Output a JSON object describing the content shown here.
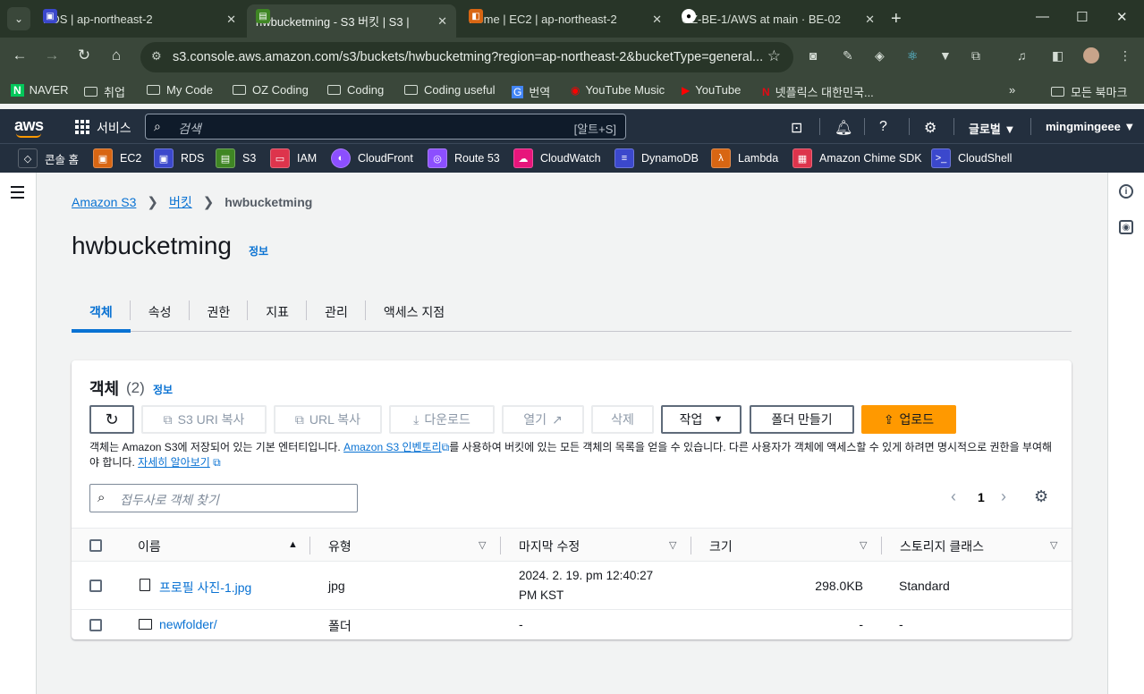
{
  "browser": {
    "tabs": [
      {
        "title": "RDS | ap-northeast-2",
        "color": "#3b48cc",
        "icon": "rds-icon"
      },
      {
        "title": "hwbucketming - S3 버킷 | S3 |",
        "color": "#3f8624",
        "icon": "s3-icon"
      },
      {
        "title": "Home | EC2 | ap-northeast-2",
        "color": "#d86613",
        "icon": "ec2-icon"
      },
      {
        "title": "OZ-BE-1/AWS at main · BE-02",
        "color": "#000000",
        "icon": "github-icon"
      }
    ],
    "url": "s3.console.aws.amazon.com/s3/buckets/hwbucketming?region=ap-northeast-2&bucketType=general...",
    "bookmarks": [
      "NAVER",
      "취업",
      "My Code",
      "OZ Coding",
      "Coding",
      "Coding useful",
      "번역",
      "YouTube Music",
      "YouTube",
      "넷플릭스 대한민국...",
      "모든 북마크"
    ]
  },
  "aws": {
    "logo": "aws",
    "services_label": "서비스",
    "search_placeholder": "검색",
    "search_shortcut": "[알트+S]",
    "region": "글로벌 ▼",
    "user": "mingmingeee ▼",
    "favorites": [
      {
        "label": "콘솔 홈",
        "color": "#232f3e"
      },
      {
        "label": "EC2",
        "color": "#d86613"
      },
      {
        "label": "RDS",
        "color": "#3b48cc"
      },
      {
        "label": "S3",
        "color": "#3f8624"
      },
      {
        "label": "IAM",
        "color": "#dd344c"
      },
      {
        "label": "CloudFront",
        "color": "#8c4fff"
      },
      {
        "label": "Route 53",
        "color": "#8c4fff"
      },
      {
        "label": "CloudWatch",
        "color": "#e7157b"
      },
      {
        "label": "DynamoDB",
        "color": "#3b48cc"
      },
      {
        "label": "Lambda",
        "color": "#d86613"
      },
      {
        "label": "Amazon Chime SDK",
        "color": "#dd344c"
      },
      {
        "label": "CloudShell",
        "color": "#3b48cc"
      }
    ]
  },
  "breadcrumb": {
    "root": "Amazon S3",
    "buckets": "버킷",
    "current": "hwbucketming"
  },
  "page": {
    "title": "hwbucketming",
    "info": "정보"
  },
  "tabs": [
    "객체",
    "속성",
    "권한",
    "지표",
    "관리",
    "액세스 지점"
  ],
  "objects": {
    "title": "객체",
    "count": "(2)",
    "info": "정보",
    "buttons": {
      "copy_s3_uri": "S3 URI 복사",
      "copy_url": "URL 복사",
      "download": "다운로드",
      "open": "열기",
      "delete": "삭제",
      "actions": "작업",
      "create_folder": "폴더 만들기",
      "upload": "업로드"
    },
    "description": {
      "part1": "객체는 Amazon S3에 저장되어 있는 기본 엔터티입니다. ",
      "link1": "Amazon S3 인벤토리",
      "part2": "를 사용하여 버킷에 있는 모든 객체의 목록을 얻을 수 있습니다. 다른 사용자가 객체에 액세스할 수 있게 하려면 명시적으로 권한을 부여해야 합니다. ",
      "link2": "자세히 알아보기"
    },
    "search_placeholder": "접두사로 객체 찾기",
    "page": "1",
    "columns": [
      "이름",
      "유형",
      "마지막 수정",
      "크기",
      "스토리지 클래스"
    ],
    "rows": [
      {
        "name": "프로필 사진-1.jpg",
        "type": "jpg",
        "modified": "2024. 2. 19. pm 12:40:27",
        "modified2": "PM KST",
        "size": "298.0KB",
        "storage": "Standard"
      },
      {
        "name": "newfolder/",
        "type": "폴더",
        "modified": "-",
        "size": "-",
        "storage": "-"
      }
    ]
  }
}
